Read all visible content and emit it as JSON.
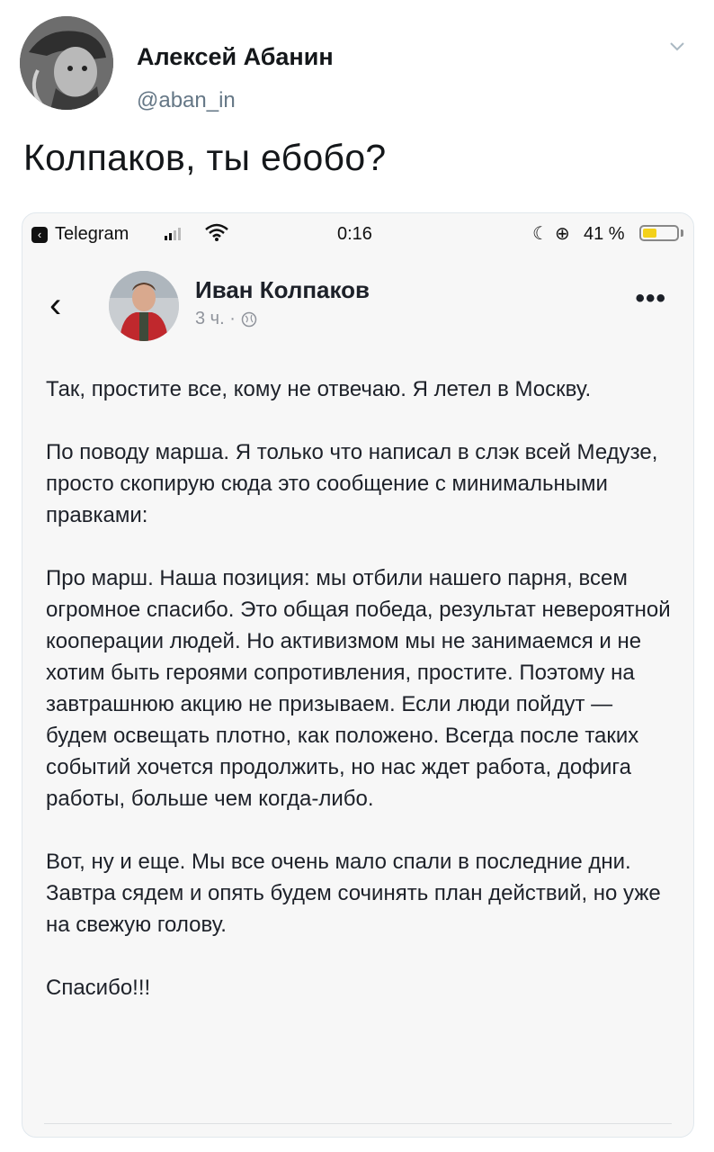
{
  "tweet": {
    "author_name": "Алексей Абанин",
    "author_handle": "@aban_in",
    "text": "Колпаков, ты ебобо?"
  },
  "status_bar": {
    "back_app": "Telegram",
    "time": "0:16",
    "battery_pct": "41 %",
    "battery_level": 0.41,
    "battery_color": "#f3d11a"
  },
  "post": {
    "author_name": "Иван Колпаков",
    "meta": "3 ч. ·",
    "more": "•••",
    "paragraphs": [
      "Так, простите все, кому не отвечаю. Я летел в Москву.",
      "По поводу марша. Я только что написал в слэк всей Медузе, просто скопирую сюда это сообщение с минимальными правками:",
      "Про марш. Наша позиция: мы отбили нашего парня, всем огромное спасибо. Это общая победа, результат невероятной кооперации людей. Но активизмом мы не занимаемся и не хотим быть героями сопротивления, простите. Поэтому на завтрашнюю акцию не призываем. Если люди пойдут — будем освещать плотно, как положено. Всегда после таких событий хочется продолжить, но нас ждет работа, дофига работы, больше чем когда-либо.",
      "Вот, ну и еще. Мы все очень мало спали в последние дни. Завтра сядем и опять будем сочинять план действий, но уже на свежую голову.",
      "Спасибо!!!"
    ]
  }
}
